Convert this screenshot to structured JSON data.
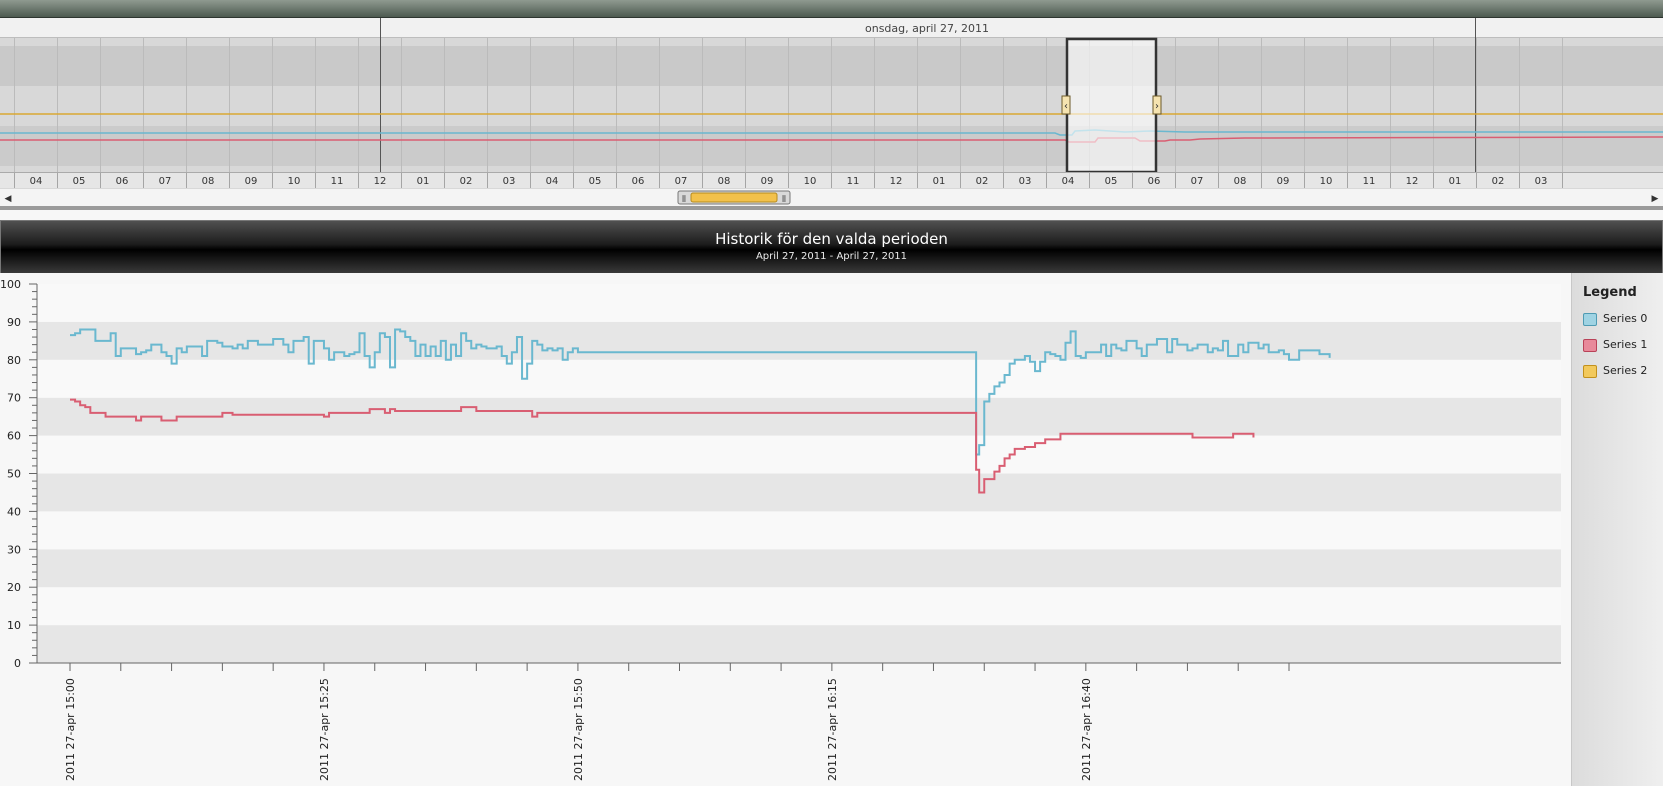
{
  "timeline": {
    "date_label": "onsdag, april 27, 2011",
    "hour_labels": [
      "04",
      "05",
      "06",
      "07",
      "08",
      "09",
      "10",
      "11",
      "12",
      "01",
      "02",
      "03",
      "04",
      "05",
      "06",
      "07",
      "08",
      "09",
      "10",
      "11",
      "12",
      "01",
      "02",
      "03",
      "04",
      "05",
      "06",
      "07",
      "08",
      "09",
      "10",
      "11",
      "12",
      "01",
      "02",
      "03"
    ]
  },
  "colors": {
    "series0": "#6ab8cf",
    "series1": "#d95e72",
    "series2": "#e7b23a"
  },
  "chart_data": {
    "type": "line",
    "title": "Historik för den valda perioden",
    "subtitle": "April 27, 2011 - April 27, 2011",
    "ylim": [
      0,
      100
    ],
    "y_ticks": [
      0,
      10,
      20,
      30,
      40,
      50,
      60,
      70,
      80,
      90,
      100
    ],
    "x_tick_labels": [
      "2011 27-apr 15:00",
      "2011 27-apr 15:25",
      "2011 27-apr 15:50",
      "2011 27-apr 16:15",
      "2011 27-apr 16:40"
    ],
    "x_range_minutes": [
      0,
      120
    ],
    "grid": true,
    "legend_title": "Legend",
    "legend_position": "right",
    "series": [
      {
        "name": "Series 0",
        "step": true,
        "points": [
          [
            0,
            86.5
          ],
          [
            0.5,
            87
          ],
          [
            1,
            88
          ],
          [
            2,
            88
          ],
          [
            2.5,
            85
          ],
          [
            4,
            87
          ],
          [
            4.5,
            81
          ],
          [
            5,
            83
          ],
          [
            6.5,
            81.5
          ],
          [
            7,
            82
          ],
          [
            7.5,
            82.5
          ],
          [
            8,
            84
          ],
          [
            9,
            82
          ],
          [
            9.5,
            81
          ],
          [
            10,
            79
          ],
          [
            10.5,
            83
          ],
          [
            11,
            82
          ],
          [
            11.5,
            83.5
          ],
          [
            13,
            81
          ],
          [
            13.5,
            85
          ],
          [
            14.5,
            84.5
          ],
          [
            15,
            83.5
          ],
          [
            16,
            83
          ],
          [
            16.5,
            84
          ],
          [
            17,
            83
          ],
          [
            17.5,
            85
          ],
          [
            18.5,
            84
          ],
          [
            19.5,
            84
          ],
          [
            20,
            85.5
          ],
          [
            21,
            84
          ],
          [
            21.5,
            82
          ],
          [
            22,
            85
          ],
          [
            23,
            86
          ],
          [
            23.5,
            79
          ],
          [
            24,
            85
          ],
          [
            25,
            83
          ],
          [
            25.5,
            80
          ],
          [
            26,
            82
          ],
          [
            27,
            81
          ],
          [
            27.5,
            81.5
          ],
          [
            28,
            82
          ],
          [
            28.5,
            87
          ],
          [
            29,
            81
          ],
          [
            29.5,
            78
          ],
          [
            30,
            82
          ],
          [
            30.5,
            87
          ],
          [
            31,
            86
          ],
          [
            31.5,
            78
          ],
          [
            32,
            88
          ],
          [
            32.5,
            87.5
          ],
          [
            33,
            86
          ],
          [
            33.5,
            85
          ],
          [
            34,
            81
          ],
          [
            34.5,
            84
          ],
          [
            35,
            81
          ],
          [
            35.5,
            83.5
          ],
          [
            36,
            81
          ],
          [
            36.5,
            85
          ],
          [
            37,
            80
          ],
          [
            37.5,
            84
          ],
          [
            38,
            81
          ],
          [
            38.5,
            87
          ],
          [
            39,
            85
          ],
          [
            39.5,
            83
          ],
          [
            40,
            84
          ],
          [
            40.5,
            83.5
          ],
          [
            41,
            83
          ],
          [
            42,
            83.5
          ],
          [
            42.5,
            81
          ],
          [
            43,
            79
          ],
          [
            43.5,
            82
          ],
          [
            44,
            86
          ],
          [
            44.5,
            75
          ],
          [
            45,
            79
          ],
          [
            45.5,
            85
          ],
          [
            46,
            84
          ],
          [
            46.5,
            82.5
          ],
          [
            47,
            83
          ],
          [
            47.5,
            82.5
          ],
          [
            48,
            83
          ],
          [
            48.5,
            80
          ],
          [
            49,
            82
          ],
          [
            49.5,
            83
          ],
          [
            50,
            82
          ],
          [
            89,
            82
          ],
          [
            89.2,
            55
          ],
          [
            89.5,
            57.5
          ],
          [
            90,
            69
          ],
          [
            90.5,
            71
          ],
          [
            91,
            73
          ],
          [
            91.5,
            74
          ],
          [
            92,
            76
          ],
          [
            92.5,
            79
          ],
          [
            93,
            80
          ],
          [
            93.5,
            80
          ],
          [
            94,
            81
          ],
          [
            94.5,
            79.5
          ],
          [
            95,
            77
          ],
          [
            95.5,
            79.5
          ],
          [
            96,
            82
          ],
          [
            96.5,
            81.5
          ],
          [
            97,
            81
          ],
          [
            97.5,
            80
          ],
          [
            98,
            84.5
          ],
          [
            98.5,
            87.5
          ],
          [
            99,
            81
          ],
          [
            99.5,
            80.5
          ],
          [
            100,
            82
          ],
          [
            101,
            82
          ],
          [
            101.5,
            84
          ],
          [
            102,
            81
          ],
          [
            102.5,
            84
          ],
          [
            103,
            83
          ],
          [
            103.5,
            82.5
          ],
          [
            104,
            85
          ],
          [
            105,
            83
          ],
          [
            105.5,
            81
          ],
          [
            106,
            84
          ],
          [
            107,
            85.5
          ],
          [
            108,
            82
          ],
          [
            108.5,
            85.5
          ],
          [
            109,
            84
          ],
          [
            110,
            82.5
          ],
          [
            110.5,
            83
          ],
          [
            111,
            84
          ],
          [
            112,
            82
          ],
          [
            112.5,
            83
          ],
          [
            113,
            82.5
          ],
          [
            113.5,
            85
          ],
          [
            114,
            81
          ],
          [
            115,
            84
          ],
          [
            115.5,
            82
          ],
          [
            116,
            84.5
          ],
          [
            117,
            83
          ],
          [
            117.5,
            84
          ],
          [
            118,
            82
          ],
          [
            118.5,
            82
          ],
          [
            119,
            82.5
          ],
          [
            119.5,
            81.5
          ],
          [
            120,
            80
          ],
          [
            121,
            82.5
          ],
          [
            122,
            82.5
          ],
          [
            123,
            81.5
          ],
          [
            124,
            80.5
          ]
        ]
      },
      {
        "name": "Series 1",
        "step": true,
        "points": [
          [
            0,
            69.5
          ],
          [
            0.5,
            69
          ],
          [
            1,
            68
          ],
          [
            1.5,
            67.5
          ],
          [
            2,
            66
          ],
          [
            3.5,
            65
          ],
          [
            6,
            65
          ],
          [
            6.5,
            64
          ],
          [
            7,
            65
          ],
          [
            9,
            64
          ],
          [
            10.5,
            65
          ],
          [
            13,
            65
          ],
          [
            15,
            66
          ],
          [
            16,
            65.5
          ],
          [
            25,
            65
          ],
          [
            25.5,
            66
          ],
          [
            29,
            66
          ],
          [
            29.5,
            67
          ],
          [
            31,
            66
          ],
          [
            31.5,
            67
          ],
          [
            32,
            66.5
          ],
          [
            38,
            66.5
          ],
          [
            38.5,
            67.5
          ],
          [
            39.5,
            67.5
          ],
          [
            40,
            66.5
          ],
          [
            45,
            66.5
          ],
          [
            45.5,
            65
          ],
          [
            46,
            66
          ],
          [
            89,
            66
          ],
          [
            89.2,
            51
          ],
          [
            89.5,
            45
          ],
          [
            90,
            48.5
          ],
          [
            91,
            50.5
          ],
          [
            91.5,
            52
          ],
          [
            92,
            54
          ],
          [
            92.5,
            55
          ],
          [
            93,
            56.5
          ],
          [
            94,
            57
          ],
          [
            95,
            58
          ],
          [
            96,
            59
          ],
          [
            97.5,
            60.5
          ],
          [
            110,
            60.5
          ],
          [
            110.5,
            59.5
          ],
          [
            114,
            59.5
          ],
          [
            114.5,
            60.5
          ],
          [
            116,
            60.5
          ],
          [
            116.5,
            59.5
          ]
        ]
      },
      {
        "name": "Series 2",
        "step": true,
        "points": []
      }
    ]
  }
}
